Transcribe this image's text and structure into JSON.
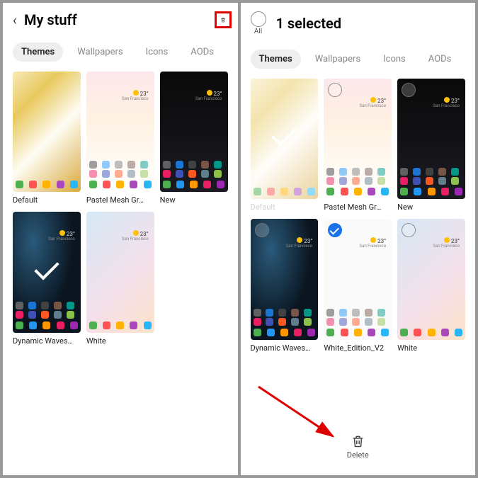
{
  "left": {
    "title": "My stuff",
    "tabs": [
      "Themes",
      "Wallpapers",
      "Icons",
      "AODs"
    ],
    "active_tab": 0,
    "themes": [
      {
        "label": "Default",
        "bg": "bg-default",
        "applied": false
      },
      {
        "label": "Pastel Mesh Gr…",
        "bg": "bg-pastel",
        "applied": false
      },
      {
        "label": "New",
        "bg": "bg-new",
        "applied": false
      },
      {
        "label": "Dynamic Waves…",
        "bg": "bg-dynamic",
        "applied": true
      },
      {
        "label": "White",
        "bg": "bg-white",
        "applied": false
      }
    ]
  },
  "right": {
    "title": "1 selected",
    "all_label": "All",
    "tabs": [
      "Themes",
      "Wallpapers",
      "Icons",
      "AODs"
    ],
    "active_tab": 0,
    "themes": [
      {
        "label": "Default",
        "bg": "bg-default",
        "dimmed": true,
        "checked": false,
        "showcircle": false
      },
      {
        "label": "Pastel Mesh Gr…",
        "bg": "bg-pastel",
        "checked": false,
        "showcircle": true
      },
      {
        "label": "New",
        "bg": "bg-new",
        "checked": false,
        "showcircle": true
      },
      {
        "label": "Dynamic Waves…",
        "bg": "bg-dynamic",
        "checked": false,
        "showcircle": true
      },
      {
        "label": "White_Edition_V2",
        "bg": "bg-white2",
        "checked": true,
        "showcircle": true
      },
      {
        "label": "White",
        "bg": "bg-white",
        "checked": false,
        "showcircle": true
      }
    ],
    "delete_label": "Delete"
  },
  "weather_temp": "23°",
  "app_colors": {
    "pastel": [
      "#4caf50",
      "#ff5252",
      "#ffb300",
      "#ab47bc",
      "#29b6f6"
    ],
    "dark": [
      "#4caf50",
      "#2196f3",
      "#ff9800",
      "#e91e63",
      "#9c27b0"
    ],
    "grid_dark": [
      "#616161",
      "#1976d2",
      "#424242",
      "#795548",
      "#009688",
      "#e91e63",
      "#3f51b5",
      "#ff5722",
      "#607d8b",
      "#8bc34a"
    ],
    "grid_light": [
      "#9e9e9e",
      "#90caf9",
      "#bdbdbd",
      "#bcaaa4",
      "#80cbc4",
      "#f48fb1",
      "#9fa8da",
      "#ffab91",
      "#b0bec5",
      "#c5e1a5"
    ]
  }
}
